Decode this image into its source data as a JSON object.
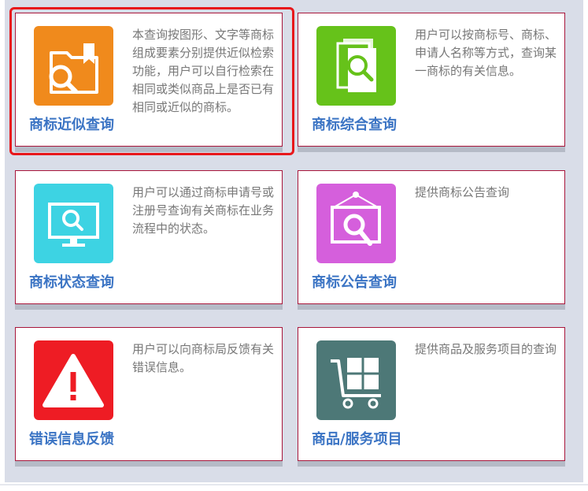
{
  "colors": {
    "card_border": "#a8163b",
    "title_text": "#3b74c4",
    "highlight": "#e8181b",
    "panel_bg": "#d9dde8"
  },
  "cards": [
    {
      "title": "商标近似查询",
      "desc": "本查询按图形、文字等商标组成要素分别提供近似检索功能，用户可以自行检索在相同或类似商品上是否已有相同或近似的商标。",
      "icon": "folder-search-icon",
      "icon_color": "#f08a1c",
      "highlighted": true
    },
    {
      "title": "商标综合查询",
      "desc": "用户可以按商标号、商标、申请人名称等方式，查询某一商标的有关信息。",
      "icon": "document-search-icon",
      "icon_color": "#66c21a"
    },
    {
      "title": "商标状态查询",
      "desc": "用户可以通过商标申请号或注册号查询有关商标在业务流程中的状态。",
      "icon": "monitor-search-icon",
      "icon_color": "#3dd3e3"
    },
    {
      "title": "商标公告查询",
      "desc": "提供商标公告查询",
      "icon": "notice-board-search-icon",
      "icon_color": "#d55fdc"
    },
    {
      "title": "错误信息反馈",
      "desc": "用户可以向商标局反馈有关错误信息。",
      "icon": "warning-icon",
      "icon_color": "#ee1c24"
    },
    {
      "title": "商品/服务项目",
      "desc": "提供商品及服务项目的查询",
      "icon": "cart-icon",
      "icon_color": "#4d7877"
    }
  ]
}
